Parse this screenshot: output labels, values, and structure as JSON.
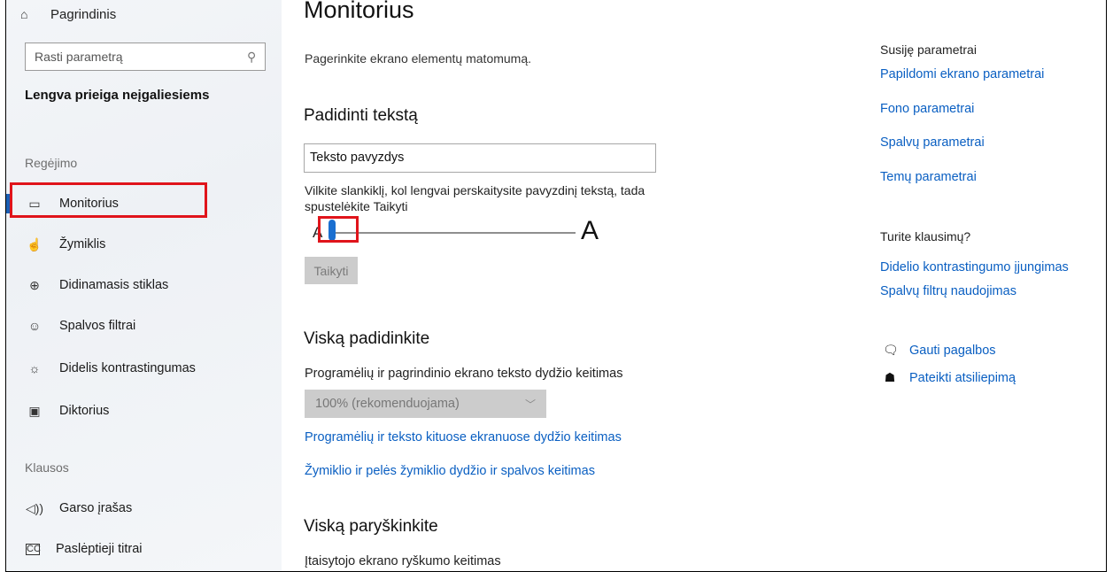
{
  "sidebar": {
    "home_label": "Pagrindinis",
    "home_icon": "home-icon",
    "search_placeholder": "Rasti parametrą",
    "heading": "Lengva prieiga neįgaliesiems",
    "group_vision": "Regėjimo",
    "group_hearing": "Klausos",
    "items": [
      {
        "label": "Monitorius",
        "icon": "monitor-icon",
        "active": true
      },
      {
        "label": "Žymiklis",
        "icon": "pointer-icon"
      },
      {
        "label": "Didinamasis stiklas",
        "icon": "magnifier-icon"
      },
      {
        "label": "Spalvos filtrai",
        "icon": "color-filter-icon"
      },
      {
        "label": "Didelis kontrastingumas",
        "icon": "contrast-icon"
      },
      {
        "label": "Diktorius",
        "icon": "narrator-icon"
      },
      {
        "label": "Garso įrašas",
        "icon": "audio-icon"
      },
      {
        "label": "Paslėptieji titrai",
        "icon": "captions-icon"
      }
    ]
  },
  "main": {
    "title": "Monitorius",
    "subtitle": "Pagerinkite ekrano elementų matomumą.",
    "enlarge_text": {
      "heading": "Padidinti tekstą",
      "sample_text": "Teksto pavyzdys",
      "instructions": "Vilkite slankiklį, kol lengvai perskaitysite pavyzdinį tekstą, tada spustelėkite Taikyti",
      "slider_min_label": "A",
      "slider_max_label": "A",
      "slider_value_fraction": 0.0,
      "apply_button": "Taikyti"
    },
    "make_bigger": {
      "heading": "Viską padidinkite",
      "scale_label": "Programėlių ir pagrindinio ekrano teksto dydžio keitimas",
      "scale_value": "100% (rekomenduojama)",
      "link_other_displays": "Programėlių ir teksto kituose ekranuose dydžio keitimas",
      "link_pointer": "Žymiklio ir pelės žymiklio dydžio ir spalvos keitimas"
    },
    "make_brighter": {
      "heading": "Viską paryškinkite",
      "brightness_label": "Įtaisytojo ekrano ryškumo keitimas"
    }
  },
  "right": {
    "related_heading": "Susiję parametrai",
    "related_links": [
      "Papildomi ekrano parametrai",
      "Fono parametrai",
      "Spalvų parametrai",
      "Temų parametrai"
    ],
    "questions_heading": "Turite klausimų?",
    "question_links": [
      "Didelio kontrastingumo įjungimas",
      "Spalvų filtrų naudojimas"
    ],
    "get_help": "Gauti pagalbos",
    "give_feedback": "Pateikti atsiliepimą"
  },
  "colors": {
    "accent": "#0a5fc2",
    "highlight": "#e0141b",
    "slider_thumb": "#1a6fd0"
  }
}
